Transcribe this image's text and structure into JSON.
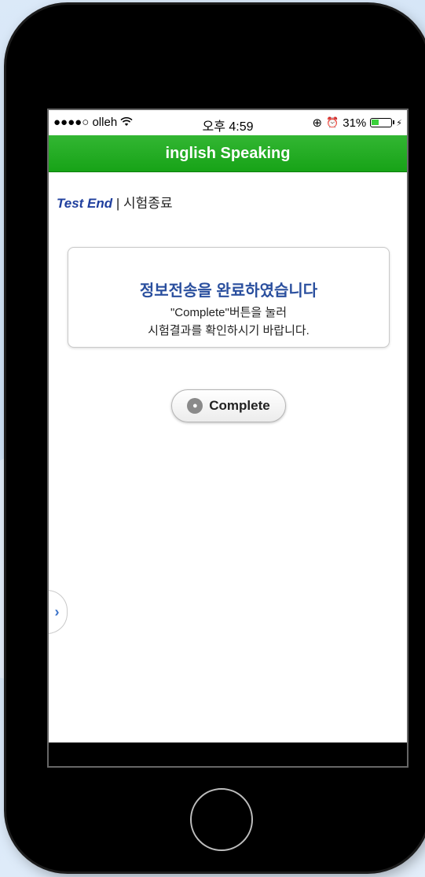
{
  "status_bar": {
    "carrier": "●●●●○ olleh",
    "wifi_icon": "wifi-icon",
    "time": "오후 4:59",
    "lock_rotation_icon": "⊕",
    "alarm_icon": "⏰",
    "battery": "31%",
    "charging_icon": "⚡"
  },
  "header": {
    "title": "inglish Speaking"
  },
  "page_title": {
    "english": "Test End",
    "separator": " | ",
    "korean": "시험종료"
  },
  "message_card": {
    "line1": "정보전송을 완료하였습니다",
    "line2": "\"Complete\"버튼을 눌러",
    "line3": "시험결과를 확인하시기 바랍니다."
  },
  "complete_button": {
    "label": "Complete"
  },
  "side_tab": {
    "label": "›"
  }
}
